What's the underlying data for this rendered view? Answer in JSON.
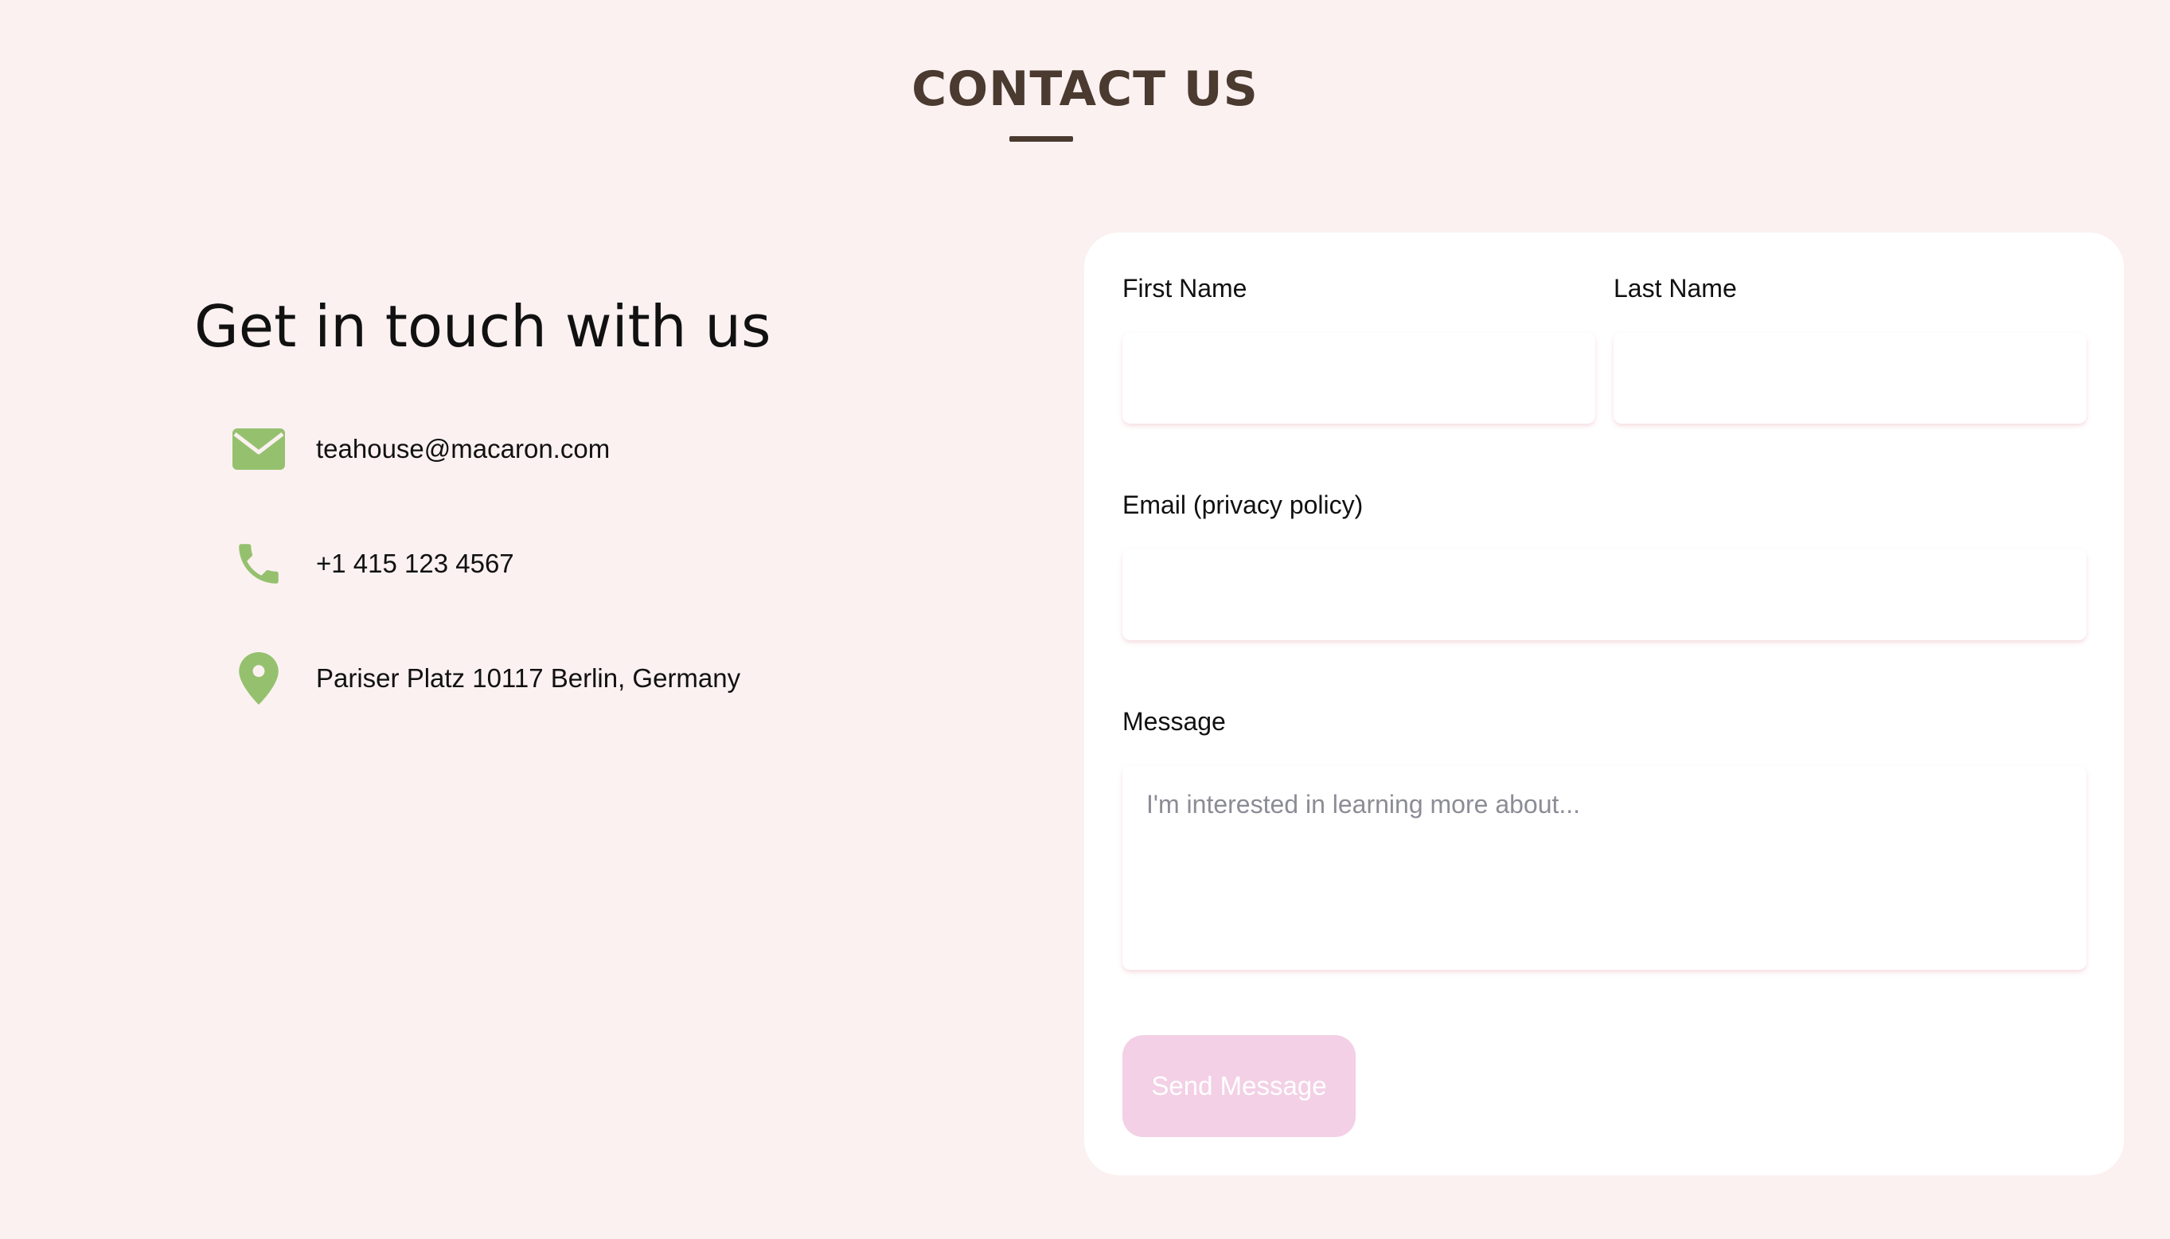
{
  "header": {
    "title": "CONTACT US"
  },
  "contact_info": {
    "heading": "Get in touch with us",
    "items": [
      {
        "icon": "envelope-icon",
        "text": "teahouse@macaron.com"
      },
      {
        "icon": "phone-icon",
        "text": "+1 415 123 4567"
      },
      {
        "icon": "map-pin-icon",
        "text": "Pariser Platz 10117 Berlin, Germany"
      }
    ]
  },
  "form": {
    "first_name_label": "First Name",
    "first_name_value": "",
    "last_name_label": "Last Name",
    "last_name_value": "",
    "email_label": "Email (privacy policy)",
    "email_value": "",
    "message_label": "Message",
    "message_placeholder": "I'm interested in learning more about...",
    "message_value": "",
    "submit_label": "Send Message"
  },
  "colors": {
    "page_background": "#fcf1f1",
    "title_color": "#4a3a2f",
    "icon_green": "#95c16f",
    "button_pink": "#f3d0e5",
    "card_background": "#ffffff"
  }
}
